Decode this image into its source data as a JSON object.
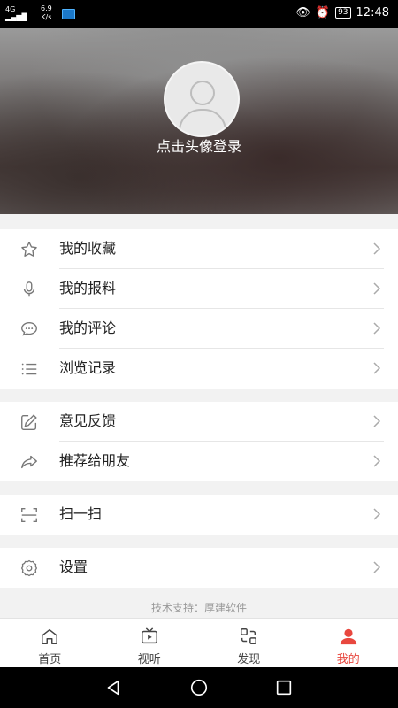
{
  "status": {
    "signal": "4G",
    "speed_value": "6.9",
    "speed_unit": "K/s",
    "battery": "93",
    "time": "12:48"
  },
  "profile": {
    "login_prompt": "点击头像登录"
  },
  "menu": {
    "group1": [
      {
        "label": "我的收藏",
        "icon": "star-icon"
      },
      {
        "label": "我的报料",
        "icon": "microphone-icon"
      },
      {
        "label": "我的评论",
        "icon": "comment-icon"
      },
      {
        "label": "浏览记录",
        "icon": "list-icon"
      }
    ],
    "group2": [
      {
        "label": "意见反馈",
        "icon": "edit-icon"
      },
      {
        "label": "推荐给朋友",
        "icon": "share-icon"
      }
    ],
    "group3": [
      {
        "label": "扫一扫",
        "icon": "scan-icon"
      }
    ],
    "group4": [
      {
        "label": "设置",
        "icon": "gear-icon"
      }
    ]
  },
  "credit": "技术支持：厚建软件",
  "tabs": [
    {
      "label": "首页",
      "icon": "home-icon",
      "active": false
    },
    {
      "label": "视听",
      "icon": "tv-play-icon",
      "active": false
    },
    {
      "label": "发现",
      "icon": "discover-icon",
      "active": false
    },
    {
      "label": "我的",
      "icon": "person-icon",
      "active": true
    }
  ],
  "colors": {
    "accent": "#e8473e",
    "background": "#f2f2f2"
  }
}
